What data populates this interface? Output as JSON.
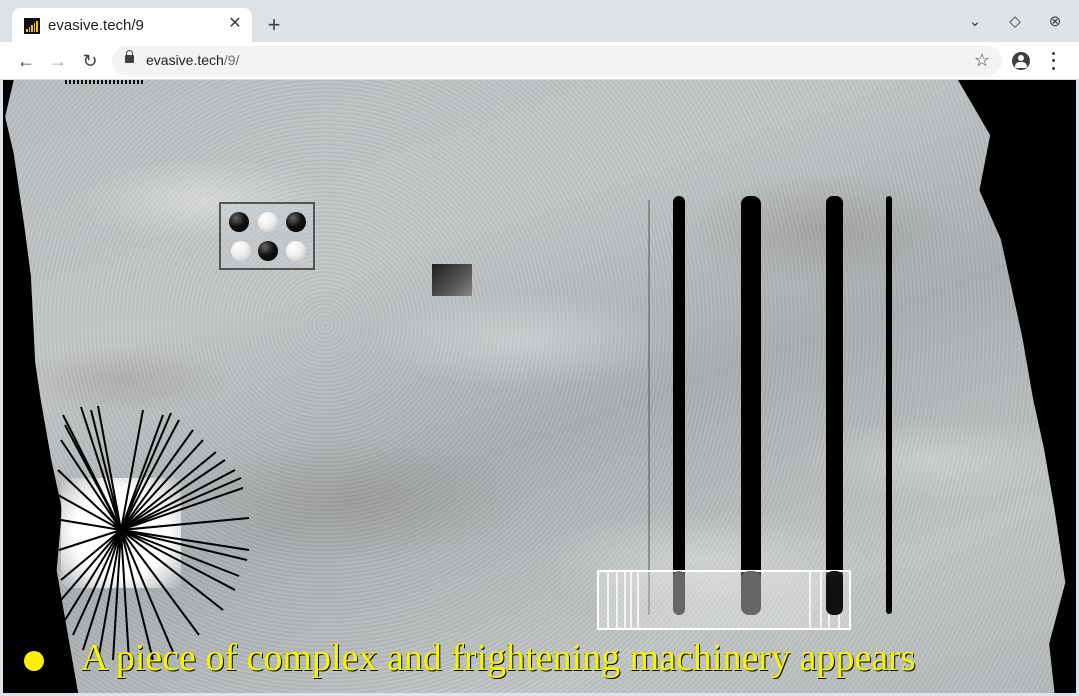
{
  "browser": {
    "tab_title": "evasive.tech/9",
    "url_host": "evasive.tech",
    "url_path": "/9/",
    "icons": {
      "favicon": "bar-chart-favicon",
      "close": "close-icon",
      "new_tab": "plus-icon",
      "back": "arrow-left-icon",
      "forward": "arrow-right-icon",
      "reload": "reload-icon",
      "lock": "lock-icon",
      "bookmark": "star-icon",
      "profile": "account-circle-icon",
      "menu": "kebab-menu-icon",
      "tab_search": "chevron-down-icon",
      "minimize": "diamond-icon",
      "window_close": "circle-x-icon"
    }
  },
  "scene": {
    "caption": "A piece of complex and frightening machinery appears",
    "caption_color": "#f5f500",
    "indicator_color": "#ffef00",
    "puzzle_balls": [
      "black",
      "white",
      "black",
      "white",
      "black",
      "white"
    ]
  }
}
